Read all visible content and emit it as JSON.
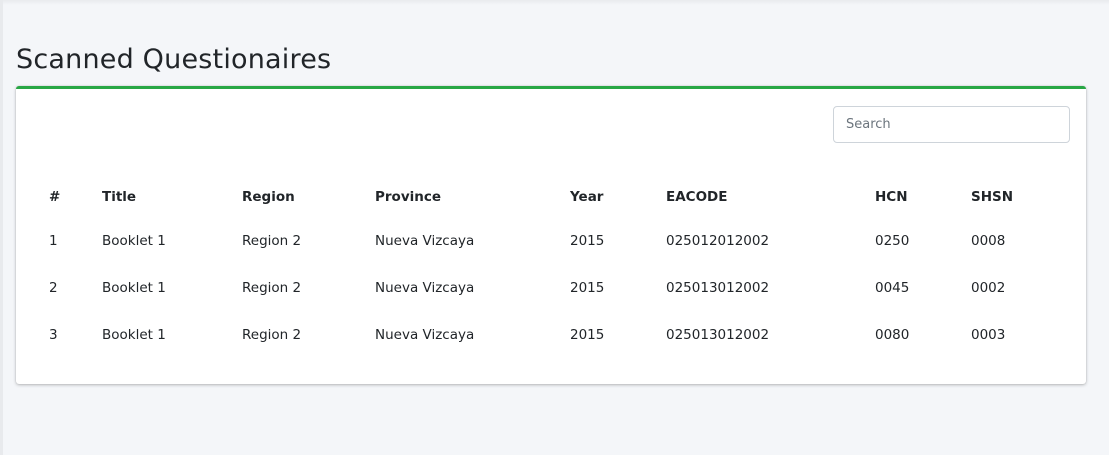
{
  "page": {
    "title": "Scanned Questionaires"
  },
  "search": {
    "placeholder": "Search",
    "value": ""
  },
  "table": {
    "headers": [
      "#",
      "Title",
      "Region",
      "Province",
      "Year",
      "EACODE",
      "HCN",
      "SHSN"
    ],
    "rows": [
      [
        "1",
        "Booklet 1",
        "Region 2",
        "Nueva Vizcaya",
        "2015",
        "025012012002",
        "0250",
        "0008"
      ],
      [
        "2",
        "Booklet 1",
        "Region 2",
        "Nueva Vizcaya",
        "2015",
        "025013012002",
        "0045",
        "0002"
      ],
      [
        "3",
        "Booklet 1",
        "Region 2",
        "Nueva Vizcaya",
        "2015",
        "025013012002",
        "0080",
        "0003"
      ]
    ]
  },
  "colors": {
    "accent": "#28a745",
    "background": "#f4f6f9",
    "card": "#ffffff"
  }
}
